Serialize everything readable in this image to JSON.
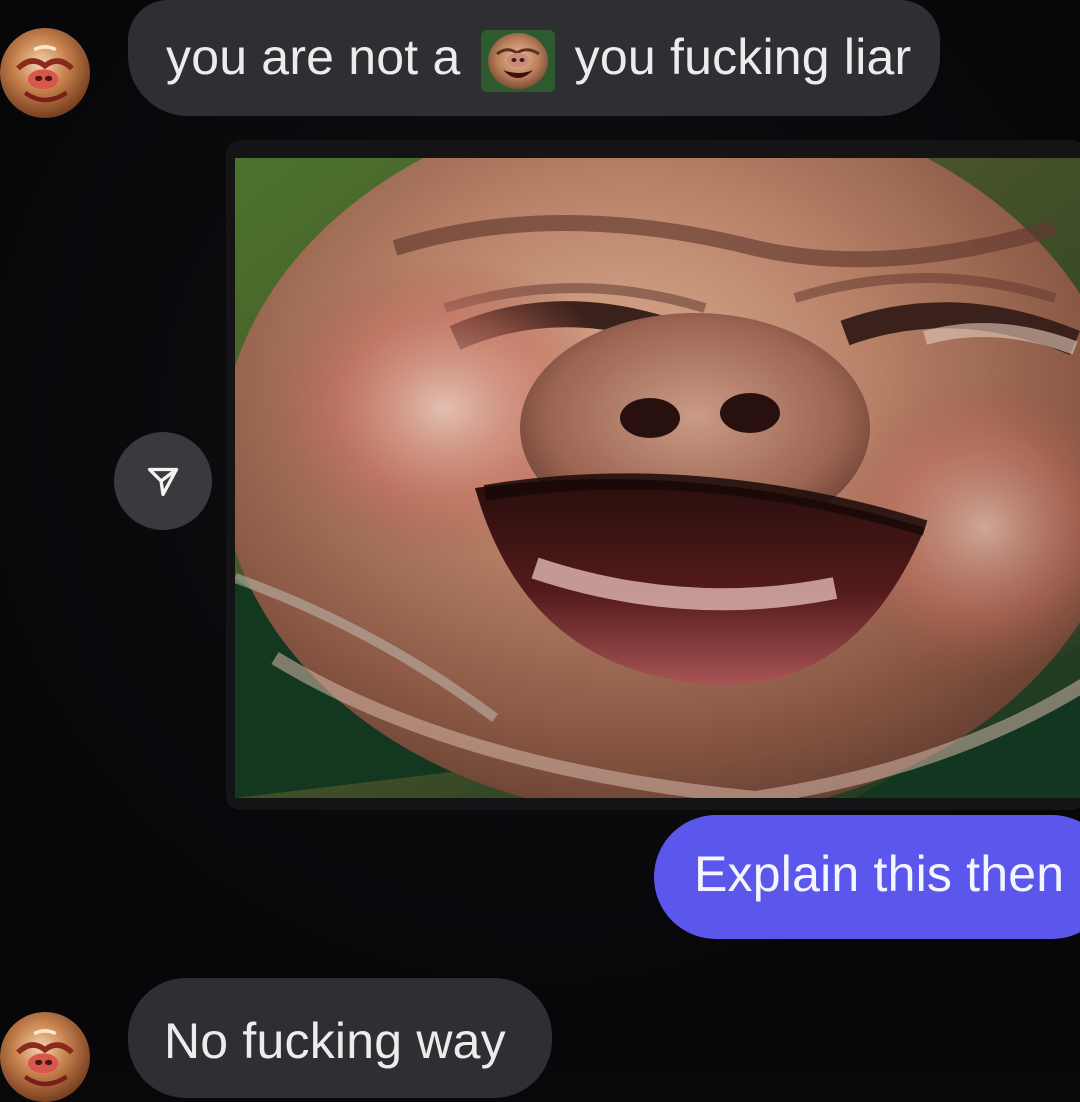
{
  "messages": [
    {
      "direction": "incoming",
      "text_before": "you are not a",
      "emoji": "laughing-pig-face-emoji",
      "text_after": "you fucking liar"
    },
    {
      "direction": "outgoing",
      "text": "Explain this then"
    },
    {
      "direction": "incoming",
      "text": "No fucking way"
    }
  ],
  "media": {
    "subject": "close-up laughing pig face"
  },
  "icons": {
    "share": "paper-plane-icon",
    "avatar": "pig-avatar"
  },
  "colors": {
    "background": "#08080a",
    "incoming_bubble": "#2f2f33",
    "outgoing_bubble": "#5b57ec",
    "text": "#ececec"
  }
}
